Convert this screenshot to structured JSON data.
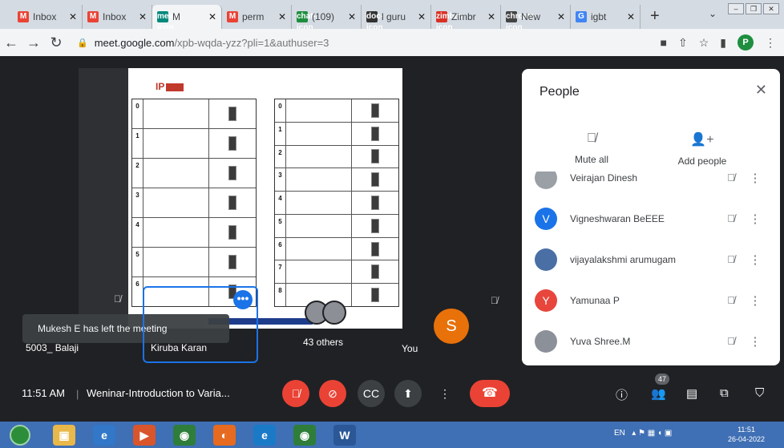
{
  "browser": {
    "tabs": [
      {
        "label": "Inbox",
        "favicon": "M",
        "color": "#ea4335"
      },
      {
        "label": "Inbox",
        "favicon": "M",
        "color": "#ea4335"
      },
      {
        "label": "M",
        "favicon": "meet-icon",
        "color": "#00897b",
        "active": true
      },
      {
        "label": "perm",
        "favicon": "M",
        "color": "#ea4335"
      },
      {
        "label": "(109)",
        "favicon": "chat-icon",
        "color": "#1e8e3e"
      },
      {
        "label": "l guru",
        "favicon": "doc-icon",
        "color": "#333333"
      },
      {
        "label": "Zimbr",
        "favicon": "zimbra-icon",
        "color": "#d93025"
      },
      {
        "label": "New",
        "favicon": "chrome-icon",
        "color": "#444444"
      },
      {
        "label": "igbt",
        "favicon": "G",
        "color": "#4285f4"
      }
    ],
    "new_tab": "+",
    "url_host": "meet.google.com",
    "url_path": "/xpb-wqda-yzz?pli=1&authuser=3",
    "profile_initial": "P"
  },
  "slide": {
    "title": "IP",
    "left_numbers": [
      "0",
      "1",
      "2",
      "3",
      "4",
      "5",
      "6"
    ],
    "right_numbers": [
      "0",
      "1",
      "2",
      "3",
      "4",
      "5",
      "6",
      "7",
      "8"
    ]
  },
  "tiles": {
    "toast": "Mukesh E has left the meeting",
    "balaji": "5003_ Balaji",
    "kiruba": "Kiruba Karan",
    "others": "43 others",
    "you": "You",
    "you_initial": "S",
    "more_badge": "•••"
  },
  "people_panel": {
    "title": "People",
    "mute_all": "Mute all",
    "add_people": "Add people",
    "participants": [
      {
        "name": "Veirajan Dinesh",
        "avatar": "",
        "color": "#9aa0a6"
      },
      {
        "name": "Vigneshwaran BeEEE",
        "avatar": "V",
        "color": "#1a73e8"
      },
      {
        "name": "vijayalakshmi arumugam",
        "avatar": "",
        "color": "#4a6fa5"
      },
      {
        "name": "Yamunaa P",
        "avatar": "Y",
        "color": "#e8453c"
      },
      {
        "name": "Yuva Shree.M",
        "avatar": "",
        "color": "#8c9099"
      }
    ]
  },
  "controls": {
    "time": "11:51 AM",
    "separator": "|",
    "meeting_title": "Weninar-Introduction to Varia...",
    "people_count": "47"
  },
  "taskbar": {
    "lang": "EN",
    "clock_time": "11:51",
    "clock_date": "26-04-2022"
  }
}
